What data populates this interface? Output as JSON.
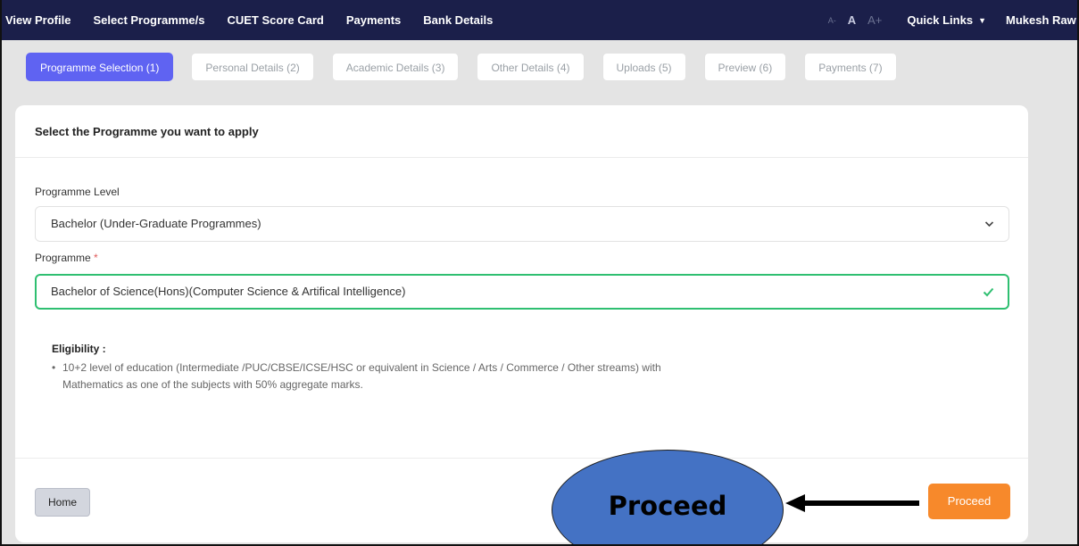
{
  "navbar": {
    "links": [
      "View Profile",
      "Select Programme/s",
      "CUET Score Card",
      "Payments",
      "Bank Details"
    ],
    "font_small": "A-",
    "font_normal": "A",
    "font_large": "A+",
    "quick_links": "Quick Links",
    "user_name": "Mukesh Raw"
  },
  "steps": [
    "Programme Selection (1)",
    "Personal Details (2)",
    "Academic Details (3)",
    "Other Details (4)",
    "Uploads (5)",
    "Preview (6)",
    "Payments (7)"
  ],
  "active_step": 0,
  "card": {
    "title": "Select the Programme you want to apply",
    "programme_level_label": "Programme Level",
    "programme_level_value": "Bachelor (Under-Graduate Programmes)",
    "programme_label": "Programme",
    "required_mark": "*",
    "programme_value": "Bachelor of Science(Hons)(Computer Science & Artifical Intelligence)",
    "eligibility_title": "Eligibility :",
    "eligibility_line1": "10+2 level of education (Intermediate /PUC/CBSE/ICSE/HSC or equivalent in Science / Arts / Commerce / Other streams) with",
    "eligibility_line2": "Mathematics as one of the subjects with 50% aggregate marks."
  },
  "footer": {
    "home_label": "Home",
    "proceed_label": "Proceed"
  },
  "annotation": {
    "callout_text": "Proceed",
    "color": "#4472c4"
  },
  "colors": {
    "navbar": "#1b1f4a",
    "active_step": "#5f63f2",
    "proceed": "#f7892b",
    "valid": "#2fbf71"
  },
  "icons": {
    "dropdown": "chevron-down-icon",
    "valid": "check-icon",
    "arrow": "arrow-left-icon"
  }
}
